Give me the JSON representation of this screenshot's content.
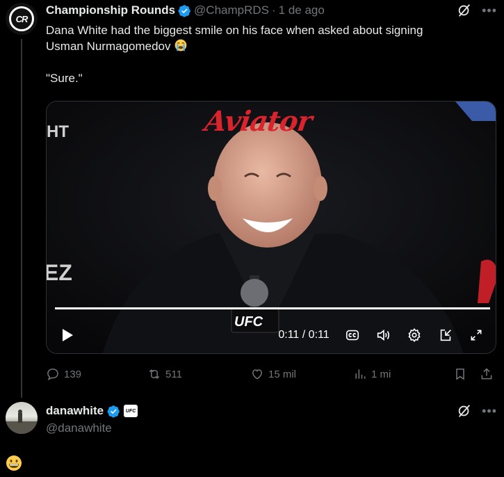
{
  "tweet": {
    "author_name": "Championship Rounds",
    "handle": "@ChampRDS",
    "separator": "·",
    "time": "1 de ago",
    "avatar_initials": "CR",
    "text_line1": "Dana White had the biggest smile on his face when asked about signing",
    "text_line2": "Usman Nurmagomedov",
    "quote": "\"Sure.\"",
    "line2_emoji": "loudly-crying-face-emoji"
  },
  "video": {
    "overlay_left_top": "HT",
    "overlay_left_bottom": "EZ",
    "backdrop_sponsor": "Aviator",
    "microphone_brand": "UFC",
    "time_display": "0:11 / 0:11",
    "progress": 1.0,
    "icons": [
      "play-icon",
      "captions-icon",
      "volume-icon",
      "settings-icon",
      "picture-in-picture-icon",
      "fullscreen-icon"
    ]
  },
  "actions": {
    "replies": "139",
    "reposts": "511",
    "likes": "15 mil",
    "views": "1 mi"
  },
  "reply": {
    "author_name": "dana​white",
    "handle": "@danawhite",
    "badge": "UFC",
    "text_emoji": "grinning-face-emoji"
  },
  "colors": {
    "background": "#000000",
    "text": "#e7e9ea",
    "muted": "#71767b",
    "verified": "#1d9bf0",
    "divider": "#333639"
  }
}
